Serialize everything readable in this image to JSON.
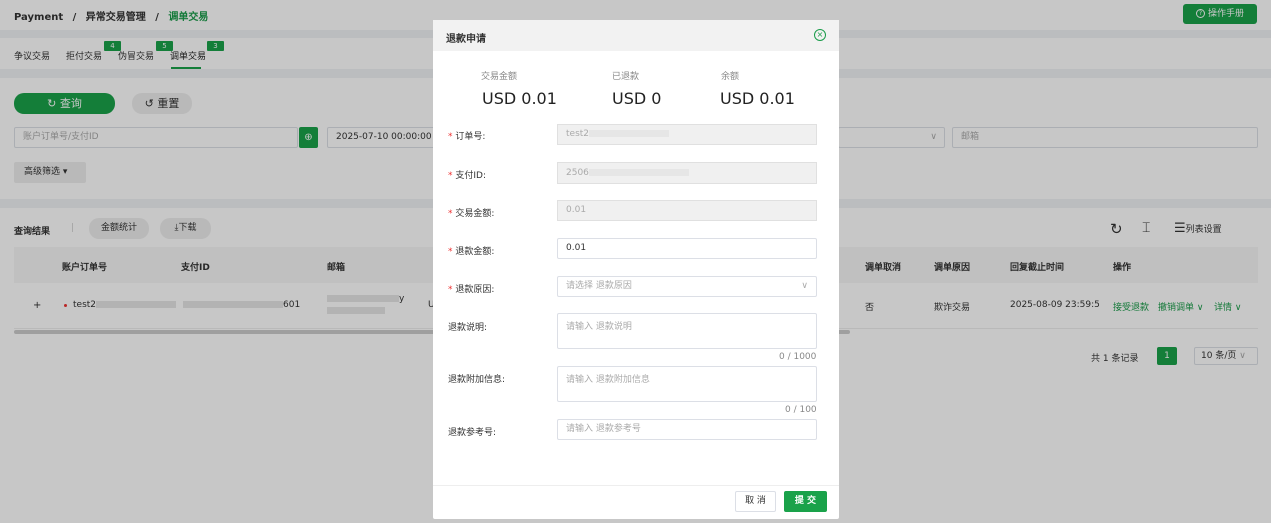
{
  "breadcrumb": {
    "root": "Payment",
    "sep": "/",
    "level2": "异常交易管理",
    "current": "调单交易"
  },
  "manual_button": "操作手册",
  "tabs": [
    {
      "label": "争议交易",
      "badge": ""
    },
    {
      "label": "拒付交易",
      "badge": "4"
    },
    {
      "label": "伪冒交易",
      "badge": "5"
    },
    {
      "label": "调单交易",
      "badge": "3"
    }
  ],
  "query_button": "查询",
  "reset_button": "重置",
  "filters": {
    "order_placeholder": "账户订单号/支付ID",
    "date_value": "2025-07-10 00:00:00",
    "email_placeholder": "邮箱",
    "advanced": "高级筛选"
  },
  "results": {
    "label": "查询结果",
    "stats_button": "金额统计",
    "download_button": "下载",
    "column_settings": "列表设置",
    "columns": [
      "账户订单号",
      "支付ID",
      "邮箱",
      "调单取消",
      "调单原因",
      "回复截止时间",
      "操作"
    ],
    "row": {
      "order": "test2",
      "payment_suffix": "601",
      "email_suffix": "y",
      "currency_prefix": "U",
      "cancel": "否",
      "reason": "欺诈交易",
      "deadline": "2025-08-09 23:59:5",
      "actions": [
        "接受退款",
        "撤销调单",
        "详情"
      ]
    },
    "total": "共 1 条记录",
    "page": "1",
    "page_size": "10 条/页"
  },
  "modal": {
    "title": "退款申请",
    "summary": [
      {
        "label": "交易金额",
        "value": "USD 0.01"
      },
      {
        "label": "已退款",
        "value": "USD 0"
      },
      {
        "label": "余额",
        "value": "USD 0.01"
      }
    ],
    "fields": {
      "order_label": "订单号:",
      "order_value": "test2",
      "payid_label": "支付ID:",
      "payid_value": "2506",
      "amount_label": "交易金额:",
      "amount_value": "0.01",
      "refund_label": "退款金额:",
      "refund_value": "0.01",
      "reason_label": "退款原因:",
      "reason_placeholder": "请选择 退款原因",
      "desc_label": "退款说明:",
      "desc_placeholder": "请输入 退款说明",
      "desc_count": "0 / 1000",
      "extra_label": "退款附加信息:",
      "extra_placeholder": "请输入 退款附加信息",
      "extra_count": "0 / 100",
      "ref_label": "退款参考号:",
      "ref_placeholder": "请输入 退款参考号"
    },
    "cancel_button": "取 消",
    "submit_button": "提 交"
  }
}
